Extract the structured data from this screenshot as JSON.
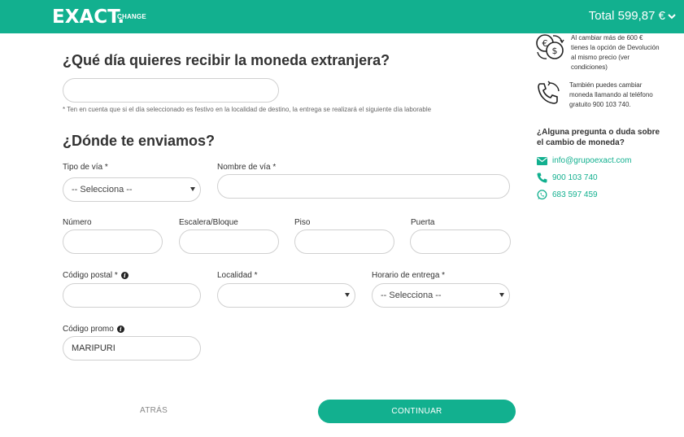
{
  "header": {
    "logo_main": "EXACT.",
    "logo_sub": "CHANGE",
    "total_label": "Total 599,87 €"
  },
  "date_section": {
    "title": "¿Qué día quieres recibir la moneda extranjera?",
    "date_value": "",
    "note": "* Ten en cuenta que si el día seleccionado es festivo en la localidad de destino, la entrega se realizará el siguiente día laborable"
  },
  "address_section": {
    "title": "¿Dónde te enviamos?",
    "fields": {
      "tipo_via": {
        "label": "Tipo de vía *",
        "value": "-- Selecciona --"
      },
      "nombre_via": {
        "label": "Nombre de vía *",
        "value": ""
      },
      "numero": {
        "label": "Número",
        "value": ""
      },
      "escalera": {
        "label": "Escalera/Bloque",
        "value": ""
      },
      "piso": {
        "label": "Piso",
        "value": ""
      },
      "puerta": {
        "label": "Puerta",
        "value": ""
      },
      "codigo_postal": {
        "label": "Código postal *",
        "value": ""
      },
      "localidad": {
        "label": "Localidad *",
        "value": ""
      },
      "horario": {
        "label": "Horario de entrega *",
        "value": "-- Selecciona --"
      },
      "codigo_promo": {
        "label": "Código promo",
        "value": "MARIPURI"
      }
    }
  },
  "actions": {
    "back_label": "ATRÁS",
    "continue_label": "CONTINUAR"
  },
  "sidebar": {
    "refund_text": "Al cambiar más de 600 € tienes la opción de Devolución al mismo precio (ver condiciones)",
    "phone_text": "También puedes cambiar moneda llamando al teléfono gratuito 900 103 740.",
    "question": "¿Alguna pregunta o duda sobre el cambio de moneda?",
    "email": "info@grupoexact.com",
    "phone": "900 103 740",
    "whatsapp": "683 597 459"
  },
  "colors": {
    "brand": "#12b08f"
  }
}
